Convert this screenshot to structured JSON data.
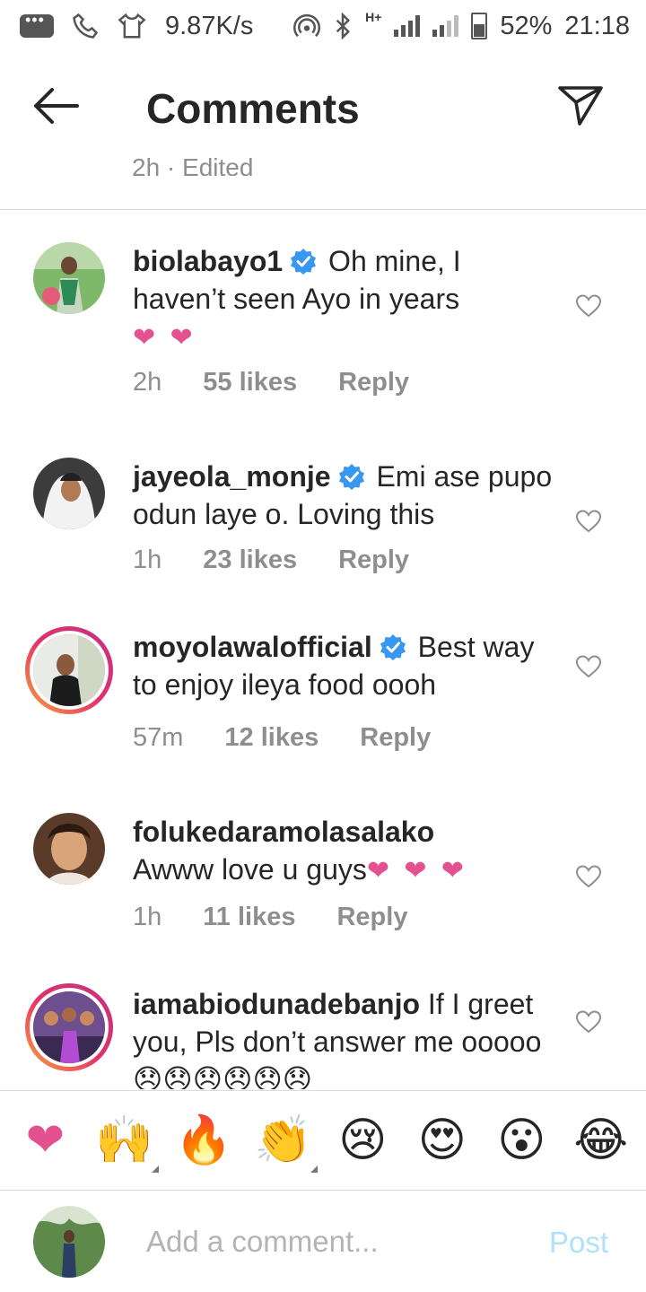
{
  "status_bar": {
    "speed": "9.87K/s",
    "network": "H+",
    "battery": "52%",
    "time": "21:18"
  },
  "header": {
    "title": "Comments"
  },
  "edited_peek": "2h · Edited",
  "comments": [
    {
      "user": "biolabayo1",
      "verified": true,
      "text": " Oh mine, I haven’t seen Ayo in years",
      "emoji": "❤ ❤",
      "time": "2h",
      "likes": "55 likes",
      "reply": "Reply"
    },
    {
      "user": "jayeola_monje",
      "verified": true,
      "text": " Emi ase pupo odun laye o. Loving this",
      "time": "1h",
      "likes": "23 likes",
      "reply": "Reply"
    },
    {
      "user": "moyolawalofficial",
      "verified": true,
      "text": " Best way to enjoy ileya food oooh",
      "time": "57m",
      "likes": "12 likes",
      "reply": "Reply"
    },
    {
      "user": "folukedaramolasalako",
      "verified": false,
      "text": "Awww love u guys",
      "emoji": "❤ ❤ ❤",
      "time": "1h",
      "likes": "11 likes",
      "reply": "Reply"
    },
    {
      "user": "iamabiodunadebanjo",
      "verified": false,
      "text": " If I greet you, Pls don’t answer me ooooo",
      "emoji": "😞😞😞😞😞😞"
    }
  ],
  "emoji_bar": [
    "❤",
    "🙌",
    "🔥",
    "👏",
    "😢",
    "😍",
    "😮",
    "😂"
  ],
  "composer": {
    "placeholder": "Add a comment...",
    "post_label": "Post"
  },
  "colors": {
    "verified": "#3897f0",
    "heart_pink": "#e4518f",
    "post_disabled": "#b2dffc",
    "secondary_text": "#8e8e8e"
  }
}
